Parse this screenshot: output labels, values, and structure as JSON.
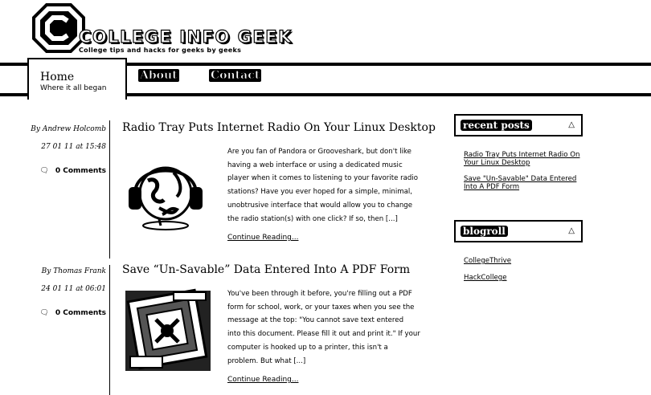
{
  "site": {
    "title": "COLLEGE INFO GEEK",
    "tagline": "College tips and hacks for geeks by geeks"
  },
  "nav": {
    "home_label": "Home",
    "home_sub": "Where it all began",
    "about_label": "About",
    "contact_label": "Contact"
  },
  "posts": [
    {
      "author": "By Andrew Holcomb",
      "date": "27 01 11 at 15:48",
      "comments": "0 Comments",
      "title": "Radio Tray Puts Internet Radio On Your Linux Desktop",
      "excerpt_lines": [
        "Are you fan of Pandora or Grooveshark, but don't like",
        "having a web interface or using a dedicated music",
        "player when it comes to listening to your favorite radio",
        "stations? Have you ever hoped for a simple, minimal,",
        "unobtrusive interface that would allow you to change",
        "the radio station(s) with one click? If so, then [...]"
      ],
      "more": "Continue Reading..."
    },
    {
      "author": "By Thomas Frank",
      "date": "24 01 11 at 06:01",
      "comments": "0 Comments",
      "title": "Save “Un-Savable” Data Entered Into A PDF Form",
      "excerpt_lines": [
        "You've been through it before, you're filling out a PDF",
        "form for school, work, or your taxes when you see the",
        "message at the top: \"You cannot save text entered",
        "into this document. Please fill it out and print it.\" If your",
        "computer is hooked up to a printer, this isn't a",
        "problem. But what [...]"
      ],
      "more": "Continue Reading..."
    }
  ],
  "sidebar": {
    "recent_title": "recent posts",
    "recent_links": [
      "Radio Tray Puts Internet Radio On Your Linux Desktop",
      "Save \"Un-Savable\" Data Entered Into A PDF Form"
    ],
    "blogroll_title": "blogroll",
    "blogroll_links": [
      "CollegeThrive",
      "HackCollege"
    ]
  }
}
